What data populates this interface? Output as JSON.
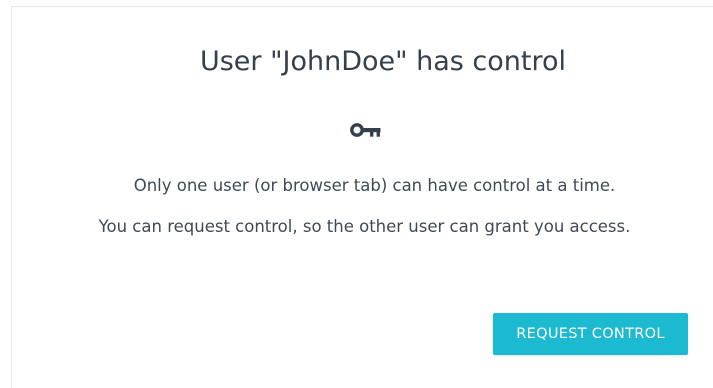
{
  "dialog": {
    "title": "User \"JohnDoe\" has control",
    "icon": "key-icon",
    "message_line_1": "Only one user (or browser tab) can have control at a time.",
    "message_line_2": "You can request control, so the other user can grant you access.",
    "request_button_label": "REQUEST CONTROL"
  },
  "colors": {
    "text": "#35404d",
    "accent": "#1cbad0",
    "button_text": "#ffffff"
  }
}
